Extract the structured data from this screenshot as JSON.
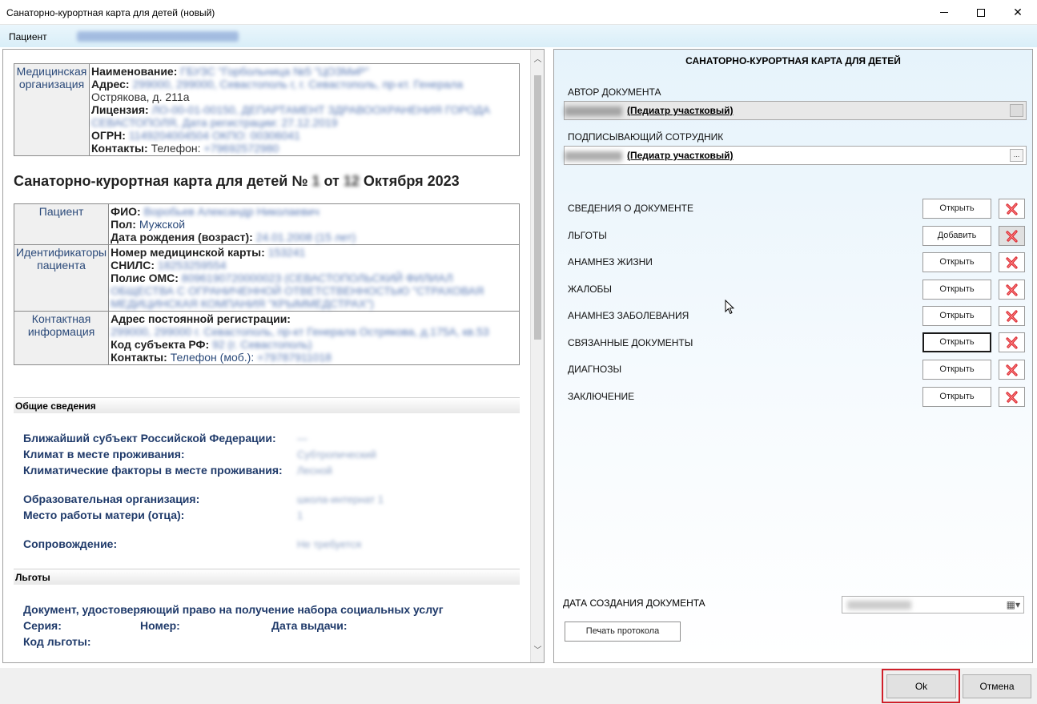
{
  "window": {
    "title": "Санаторно-курортная карта для детей (новый)"
  },
  "patient_bar": {
    "label": "Пациент"
  },
  "document": {
    "org_header": "Медицинская организация",
    "org_name_label": "Наименование:",
    "org_name_value": "ГБУЗС \"Горбольница №5 \"ЦОЗМиР\"",
    "org_address_label": "Адрес:",
    "org_address_value": "299000, 299000, Севастополь г, г. Севастополь, пр-кт. Генерала",
    "org_address_line2": "Острякова, д. 211а",
    "org_license_label": "Лицензия:",
    "org_license_value": "ЛО-00-01-00150, ДЕПАРТАМЕНТ ЗДРАВООХРАНЕНИЯ ГОРОДА",
    "org_license_line2": "СЕВАСТОПОЛЯ, Дата регистрации: 27.12.2019",
    "org_ogrn_label": "ОГРН:",
    "org_ogrn_value": "1149204004504 ОКПО: 00306041",
    "org_contacts_label": "Контакты:",
    "org_contacts_value": "Телефон:",
    "org_contacts_phone": "+79692572980",
    "title_prefix": "Санаторно-курортная карта для детей №",
    "title_num": "1",
    "title_from": "от",
    "title_day": "12",
    "title_suffix": "Октября 2023",
    "patient_header": "Пациент",
    "fio_label": "ФИО:",
    "fio_value": "Воробьев Александр Николаевич",
    "sex_label": "Пол:",
    "sex_value": "Мужской",
    "dob_label": "Дата рождения (возраст):",
    "dob_value": "24.01.2008 (15 лет)",
    "ids_header": "Идентификаторы пациента",
    "card_label": "Номер медицинской карты:",
    "card_value": "153241",
    "snils_label": "СНИЛС:",
    "snils_value": "18253259554",
    "oms_label": "Полис ОМС:",
    "oms_value": "8096190720000023 (СЕВАСТОПОЛЬСКИЙ ФИЛИАЛ",
    "oms_line2": "ОБЩЕСТВА С ОГРАНИЧЕННОЙ ОТВЕТСТВЕННОСТЬЮ \"СТРАХОВАЯ",
    "oms_line3": "МЕДИЦИНСКАЯ КОМПАНИЯ \"КРЫММЕДСТРАХ\")",
    "contact_header": "Контактная информация",
    "reg_label": "Адрес постоянной регистрации:",
    "reg_value": "299000, 299000 г. Севастополь, пр-кт Генерала Острякова, д.175А, кв.53",
    "region_label": "Код субъекта РФ:",
    "region_value": "92 (г. Севастополь)",
    "contacts_label": "Контакты:",
    "contacts_value": "Телефон (моб.):",
    "contacts_phone": "+79787911018",
    "general_section": "Общие сведения",
    "nearest_label": "Ближайший субъект Российской Федерации:",
    "nearest_value": "—",
    "climate_label": "Климат в месте проживания:",
    "climate_value": "Субтропический",
    "climate_factors_label": "Климатические факторы в месте проживания:",
    "climate_factors_value": "Лесной",
    "edu_label": "Образовательная организация:",
    "edu_value": "школа-интернат 1",
    "mother_work_label": "Место работы матери (отца):",
    "mother_work_value": "1",
    "escort_label": "Сопровождение:",
    "escort_value": "Не требуется",
    "benefits_section": "Льготы",
    "benefit_doc_label": "Документ, удостоверяющий право на получение набора социальных услуг",
    "series_label": "Серия:",
    "number_label": "Номер:",
    "issue_date_label": "Дата выдачи:",
    "benefit_code_label": "Код льготы:"
  },
  "right_panel": {
    "title": "САНАТОРНО-КУРОРТНАЯ КАРТА ДЛЯ ДЕТЕЙ",
    "author_label": "АВТОР ДОКУМЕНТА",
    "author_role": "(Педиатр участковый)",
    "signer_label": "ПОДПИСЫВАЮЩИЙ СОТРУДНИК",
    "signer_role": "(Педиатр участковый)",
    "ellipsis": "...",
    "sections": [
      {
        "label": "СВЕДЕНИЯ О ДОКУМЕНТЕ",
        "button": "Открыть"
      },
      {
        "label": "ЛЬГОТЫ",
        "button": "Добавить"
      },
      {
        "label": "АНАМНЕЗ ЖИЗНИ",
        "button": "Открыть"
      },
      {
        "label": "ЖАЛОБЫ",
        "button": "Открыть"
      },
      {
        "label": "АНАМНЕЗ ЗАБОЛЕВАНИЯ",
        "button": "Открыть"
      },
      {
        "label": "СВЯЗАННЫЕ ДОКУМЕНТЫ",
        "button": "Открыть"
      },
      {
        "label": "ДИАГНОЗЫ",
        "button": "Открыть"
      },
      {
        "label": "ЗАКЛЮЧЕНИЕ",
        "button": "Открыть"
      }
    ],
    "date_label": "ДАТА СОЗДАНИЯ ДОКУМЕНТА",
    "date_value": "12 октября 2023 г.",
    "print_button": "Печать протокола"
  },
  "footer": {
    "ok": "Ok",
    "cancel": "Отмена"
  },
  "colors": {
    "accent_outline": "#d01f2a",
    "delete_icon": "#d9262e",
    "link_text": "#2b4a7a"
  }
}
